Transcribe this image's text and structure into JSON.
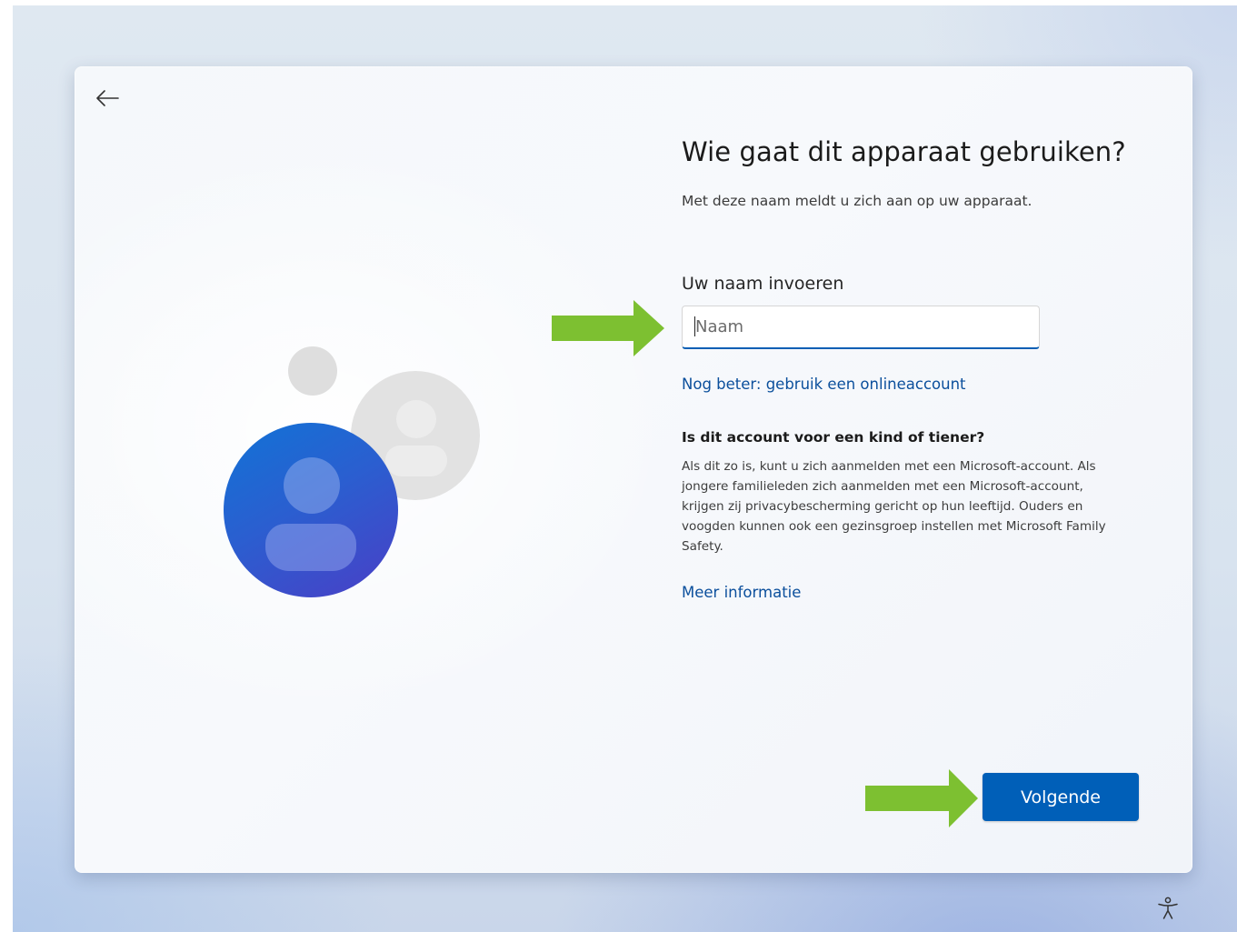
{
  "window": {
    "back_icon": "arrow-left-icon",
    "accessibility_icon": "accessibility-icon"
  },
  "page": {
    "title": "Wie gaat dit apparaat gebruiken?",
    "subtitle": "Met deze naam meldt u zich aan op uw apparaat.",
    "name_field": {
      "label": "Uw naam invoeren",
      "placeholder": "Naam",
      "value": ""
    },
    "online_account_link": "Nog beter: gebruik een onlineaccount",
    "child_section": {
      "heading": "Is dit account voor een kind of tiener?",
      "body": "Als dit zo is, kunt u zich aanmelden met een Microsoft-account. Als jongere familieleden zich aanmelden met een Microsoft-account, krijgen zij privacybescherming gericht op hun leeftijd. Ouders en voogden kunnen ook een gezinsgroep instellen met Microsoft Family Safety."
    },
    "more_info_link": "Meer informatie",
    "next_button": "Volgende"
  },
  "colors": {
    "accent": "#005fb8",
    "link": "#0b4f9c",
    "annotation_arrow": "#7dc031"
  }
}
